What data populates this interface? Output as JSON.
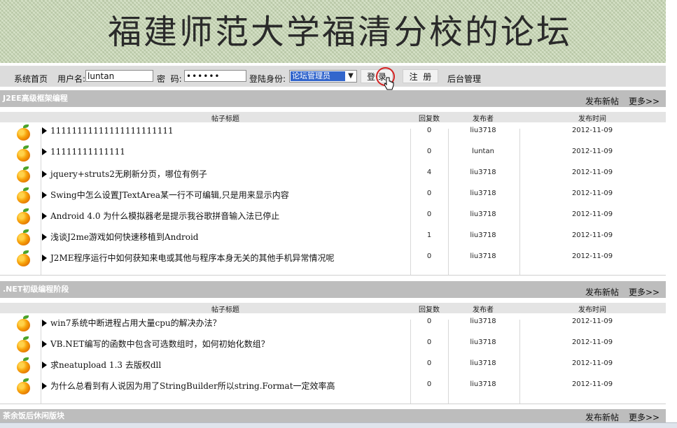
{
  "banner": {
    "title": "福建师范大学福清分校的论坛"
  },
  "login": {
    "home": "系统首页",
    "username_label": "用户名:",
    "username_value": "luntan",
    "password_label": "密  码:",
    "password_value": "••••••",
    "role_label": "登陆身份:",
    "role_value": "论坛管理员",
    "login_btn": "登 录",
    "register_btn": "注  册",
    "admin": "后台管理"
  },
  "columns": {
    "title": "帖子标题",
    "replies": "回复数",
    "author": "发布者",
    "time": "发布时间"
  },
  "sections": [
    {
      "name": "J2EE高级框架编程",
      "new_post": "发布新帖",
      "more": "更多>>",
      "posts": [
        {
          "title": "11111111111111111111111",
          "replies": "0",
          "author": "liu3718",
          "time": "2012-11-09"
        },
        {
          "title": "11111111111111",
          "replies": "0",
          "author": "luntan",
          "time": "2012-11-09"
        },
        {
          "title": "jquery+struts2无刷新分页，哪位有例子",
          "replies": "4",
          "author": "liu3718",
          "time": "2012-11-09"
        },
        {
          "title": "Swing中怎么设置JTextArea某一行不可编辑,只是用来显示内容",
          "replies": "0",
          "author": "liu3718",
          "time": "2012-11-09"
        },
        {
          "title": "Android 4.0 为什么模拟器老是提示我谷歌拼音输入法已停止",
          "replies": "0",
          "author": "liu3718",
          "time": "2012-11-09"
        },
        {
          "title": "浅谈J2me游戏如何快速移植到Android",
          "replies": "1",
          "author": "liu3718",
          "time": "2012-11-09"
        },
        {
          "title": "J2ME程序运行中如何获知来电或其他与程序本身无关的其他手机异常情况呢",
          "replies": "0",
          "author": "liu3718",
          "time": "2012-11-09"
        }
      ]
    },
    {
      "name": ".NET初级编程阶段",
      "new_post": "发布新帖",
      "more": "更多>>",
      "posts": [
        {
          "title": "win7系统中断进程占用大量cpu的解决办法？",
          "replies": "0",
          "author": "liu3718",
          "time": "2012-11-09"
        },
        {
          "title": "VB.NET编写的函数中包含可选数组时，如何初始化数组？",
          "replies": "0",
          "author": "liu3718",
          "time": "2012-11-09"
        },
        {
          "title": "求neatupload 1.3 去版权dll",
          "replies": "0",
          "author": "liu3718",
          "time": "2012-11-09"
        },
        {
          "title": "为什么总看到有人说因为用了StringBuilder所以string.Format一定效率高",
          "replies": "0",
          "author": "liu3718",
          "time": "2012-11-09"
        }
      ]
    },
    {
      "name": "茶余饭后休闲版块",
      "new_post": "发布新帖",
      "more": "更多>>",
      "posts": []
    }
  ],
  "icons": {
    "post": "orange-fruit-icon",
    "row_marker": "triangle-right-icon",
    "cursor": "hand-pointer-icon"
  },
  "colors": {
    "banner_bg": "#c8d8b4",
    "header_gray": "#bdbdbd",
    "select_highlight": "#3366cc",
    "ring": "#d42020"
  }
}
